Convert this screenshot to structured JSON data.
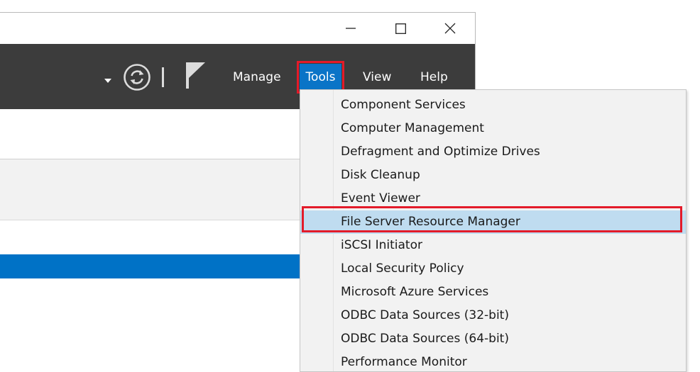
{
  "window": {
    "controls": [
      {
        "name": "minimize-button",
        "icon": "minimize-icon"
      },
      {
        "name": "maximize-button",
        "icon": "maximize-icon"
      },
      {
        "name": "close-button",
        "icon": "close-icon"
      }
    ]
  },
  "toolbar": {
    "icons": [
      "dropdown-arrow-icon",
      "refresh-icon",
      "separator",
      "flag-icon"
    ],
    "menus": [
      {
        "label": "Manage"
      },
      {
        "label": "Tools",
        "active": true
      },
      {
        "label": "View"
      },
      {
        "label": "Help"
      }
    ],
    "colors": {
      "background": "#3c3c3c",
      "active_menu": "#0a74c7",
      "highlight_outline": "#e31b2a"
    }
  },
  "tools_menu": {
    "items": [
      {
        "label": "Component Services"
      },
      {
        "label": "Computer Management"
      },
      {
        "label": "Defragment and Optimize Drives"
      },
      {
        "label": "Disk Cleanup"
      },
      {
        "label": "Event Viewer"
      },
      {
        "label": "File Server Resource Manager",
        "highlighted": true
      },
      {
        "label": "iSCSI Initiator"
      },
      {
        "label": "Local Security Policy"
      },
      {
        "label": "Microsoft Azure Services"
      },
      {
        "label": "ODBC Data Sources (32-bit)"
      },
      {
        "label": "ODBC Data Sources (64-bit)"
      },
      {
        "label": "Performance Monitor"
      }
    ],
    "colors": {
      "background": "#f2f2f2",
      "highlight": "#bfdcf0"
    }
  },
  "content": {
    "selected_row_color": "#0072c6"
  }
}
